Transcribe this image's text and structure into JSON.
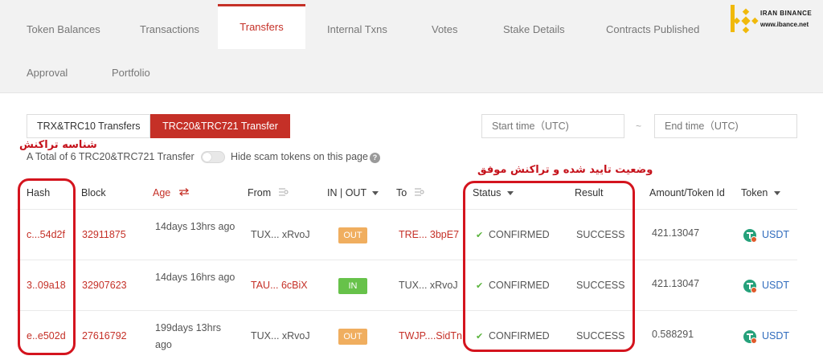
{
  "tabs": [
    {
      "label": "Token Balances",
      "active": false
    },
    {
      "label": "Transactions",
      "active": false
    },
    {
      "label": "Transfers",
      "active": true
    },
    {
      "label": "Internal Txns",
      "active": false
    },
    {
      "label": "Votes",
      "active": false
    },
    {
      "label": "Stake Details",
      "active": false
    },
    {
      "label": "Contracts Published",
      "active": false
    },
    {
      "label": "Approval",
      "active": false
    },
    {
      "label": "Portfolio",
      "active": false
    }
  ],
  "logo": {
    "line1": "IRAN BINANCE",
    "line2": "www.ibance.net"
  },
  "filters": {
    "trx_button": "TRX&TRC10 Transfers",
    "trc20_button": "TRC20&TRC721 Transfer",
    "start_placeholder": "Start time（UTC)",
    "end_placeholder": "End time（UTC)",
    "separator": "~"
  },
  "annotations": {
    "hash_label": "شناسه تراکنش",
    "status_label": "وضعیت تایید شده و تراکنش موفق"
  },
  "summary": {
    "total_text": "A Total of 6 TRC20&TRC721 Transfer",
    "hide_scam_label": "Hide scam tokens on this page",
    "help": "?"
  },
  "table": {
    "headers": {
      "hash": "Hash",
      "block": "Block",
      "age": "Age",
      "from": "From",
      "inout": "IN | OUT",
      "to": "To",
      "status": "Status",
      "result": "Result",
      "amount": "Amount/Token Id",
      "token": "Token"
    },
    "rows": [
      {
        "hash": "c...54d2f",
        "block": "32911875",
        "age": "14days 13hrs ago",
        "from": "TUX... xRvoJ",
        "direction": "OUT",
        "to": "TRE... 3bpE7",
        "status": "CONFIRMED",
        "result": "SUCCESS",
        "amount": "421.13047",
        "token": "USDT"
      },
      {
        "hash": "3..09a18",
        "block": "32907623",
        "age": "14days 16hrs ago",
        "from": "TAU... 6cBiX",
        "direction": "IN",
        "to": "TUX... xRvoJ",
        "status": "CONFIRMED",
        "result": "SUCCESS",
        "amount": "421.13047",
        "token": "USDT"
      },
      {
        "hash": "e..e502d",
        "block": "27616792",
        "age": "199days 13hrs ago",
        "from": "TUX... xRvoJ",
        "direction": "OUT",
        "to": "TWJP....SidTn",
        "status": "CONFIRMED",
        "result": "SUCCESS",
        "amount": "0.588291",
        "token": "USDT"
      }
    ]
  },
  "colors": {
    "accent": "#c53027",
    "out_badge": "#f0ae5f",
    "in_badge": "#67c24a",
    "annotation": "#d4141e",
    "token": "#2f6bbd"
  }
}
